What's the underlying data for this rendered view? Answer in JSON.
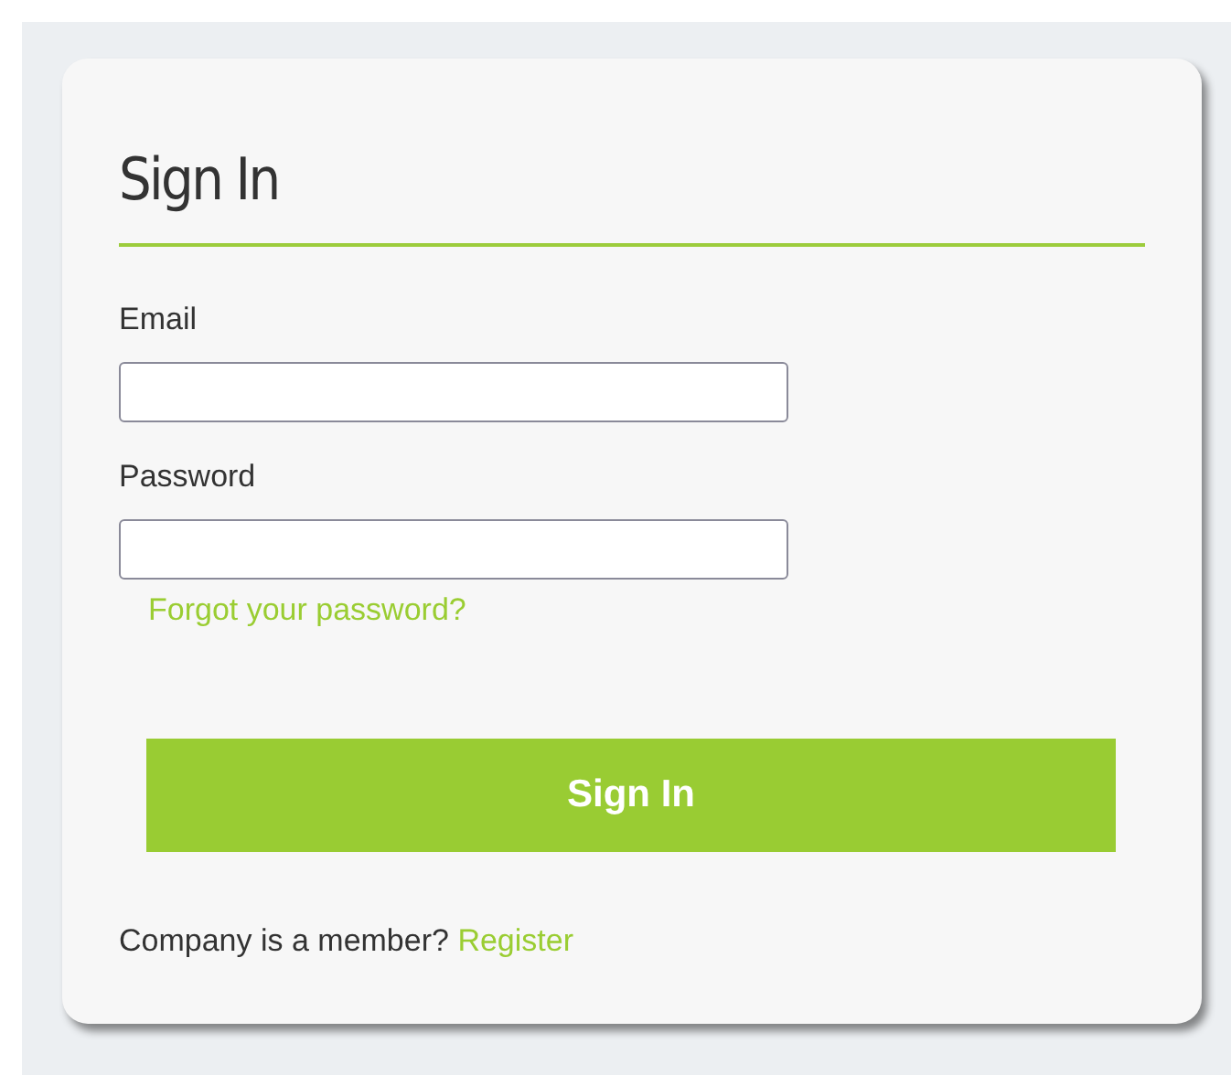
{
  "title": "Sign In",
  "fields": [
    {
      "label": "Email"
    },
    {
      "label": "Password"
    }
  ],
  "forgot_link": "Forgot your password?",
  "submit_button": "Sign In",
  "footer": {
    "text": "Company is a member?",
    "link": "Register"
  }
}
